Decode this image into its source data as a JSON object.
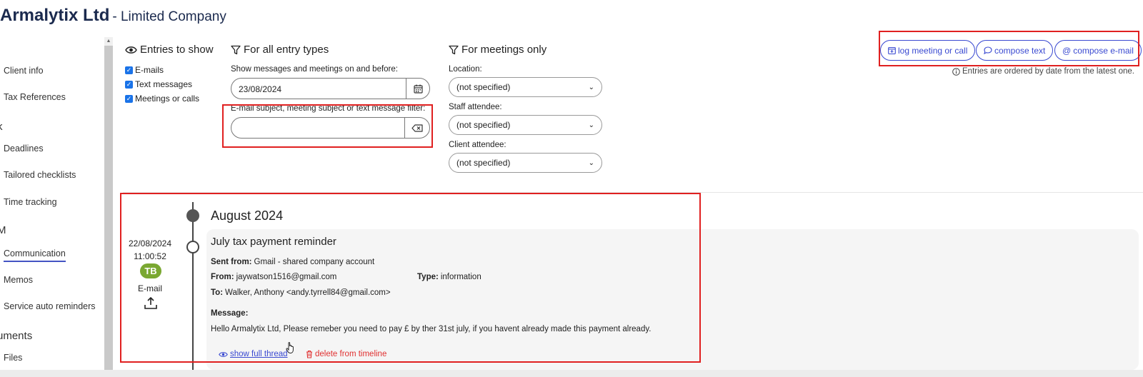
{
  "header": {
    "company_name": "Armalytix Ltd",
    "company_type": "- Limited Company"
  },
  "sidebar": {
    "items": [
      {
        "label": "Client info"
      },
      {
        "label": "Tax References"
      },
      {
        "heading": "k"
      },
      {
        "label": "Deadlines"
      },
      {
        "label": "Tailored checklists"
      },
      {
        "label": "Time tracking"
      },
      {
        "heading": "M"
      },
      {
        "label": "Communication",
        "active": true
      },
      {
        "label": "Memos"
      },
      {
        "label": "Service auto reminders"
      },
      {
        "heading": "uments"
      },
      {
        "label": "Files"
      }
    ]
  },
  "filters": {
    "entries_title": "Entries to show",
    "checkboxes": [
      {
        "label": "E-mails",
        "checked": true
      },
      {
        "label": "Text messages",
        "checked": true
      },
      {
        "label": "Meetings or calls",
        "checked": true
      }
    ],
    "all_types_title": "For all entry types",
    "date_label": "Show messages and meetings on and before:",
    "date_value": "23/08/2024",
    "subject_filter_label": "E-mail subject, meeting subject or text message filter:",
    "subject_filter_value": "",
    "meetings_title": "For meetings only",
    "location_label": "Location:",
    "location_value": "(not specified)",
    "staff_label": "Staff attendee:",
    "staff_value": "(not specified)",
    "client_label": "Client attendee:",
    "client_value": "(not specified)"
  },
  "actions": {
    "log_meeting": "log meeting or call",
    "compose_text": "compose text",
    "compose_email": "compose e-mail",
    "order_note": "Entries are ordered by date from the latest one."
  },
  "timeline": {
    "month": "August 2024",
    "entry": {
      "date": "22/08/2024",
      "time": "11:00:52",
      "initials": "TB",
      "kind": "E-mail",
      "title": "July tax payment reminder",
      "sent_from_label": "Sent from:",
      "sent_from": "Gmail - shared company account",
      "from_label": "From:",
      "from": "jaywatson1516@gmail.com",
      "type_label": "Type:",
      "type": "information",
      "to_label": "To:",
      "to": "Walker, Anthony <andy.tyrrell84@gmail.com>",
      "message_label": "Message:",
      "message": "Hello Armalytix Ltd,  Please remeber you need to pay £ by ther 31st july, if you havent already made this payment already.",
      "show_thread": "show full thread",
      "delete": "delete from timeline"
    }
  },
  "colors": {
    "accent": "#3949d1",
    "highlight": "#e02020",
    "avatar": "#7aa832"
  }
}
